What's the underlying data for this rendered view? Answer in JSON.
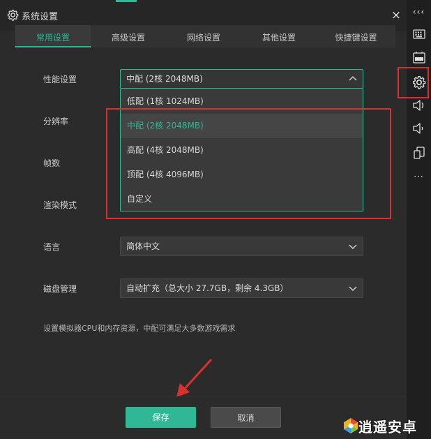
{
  "dialog": {
    "title": "系统设置",
    "close_label": "×"
  },
  "tabs": [
    {
      "label": "常用设置",
      "active": true
    },
    {
      "label": "高级设置"
    },
    {
      "label": "网络设置"
    },
    {
      "label": "其他设置"
    },
    {
      "label": "快捷键设置"
    }
  ],
  "settings": {
    "performance": {
      "label": "性能设置",
      "value": "中配 (2核 2048MB)"
    },
    "resolution": {
      "label": "分辨率"
    },
    "fps": {
      "label": "帧数"
    },
    "render": {
      "label": "渲染模式"
    },
    "language": {
      "label": "语言",
      "value": "简体中文"
    },
    "disk": {
      "label": "磁盘管理",
      "value": "自动扩充（总大小 27.7GB，剩余 4.3GB）"
    }
  },
  "dropdown_options": [
    {
      "label": "低配 (1核 1024MB)"
    },
    {
      "label": "中配 (2核 2048MB)",
      "selected": true
    },
    {
      "label": "高配 (4核 2048MB)"
    },
    {
      "label": "顶配 (4核 4096MB)"
    },
    {
      "label": "自定义"
    }
  ],
  "hint": "设置模拟器CPU和内存资源，中配可满足大多数游戏需求",
  "buttons": {
    "save": "保存",
    "cancel": "取消"
  },
  "sidebar": {
    "collapse": "‹‹‹",
    "more": "···"
  },
  "watermark": {
    "text": "逍遥安卓"
  },
  "colors": {
    "accent": "#2fb796",
    "highlight_box": "#d9322e",
    "background": "#2b2b2b"
  }
}
